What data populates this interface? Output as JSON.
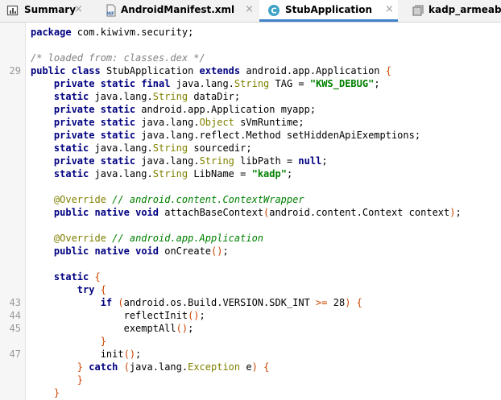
{
  "tabs": [
    {
      "label": "Summary",
      "icon": "summary-icon",
      "active": false
    },
    {
      "label": "AndroidManifest.xml",
      "icon": "manifest-file-icon",
      "active": false
    },
    {
      "label": "StubApplication",
      "icon": "class-icon",
      "active": true
    },
    {
      "label": "kadp_armeabi",
      "icon": "library-icon",
      "active": false
    }
  ],
  "tab_close_glyph": "×",
  "colors": {
    "active_tab_underline": "#4083c9",
    "keyword": "#000080",
    "string": "#008000",
    "comment": "#808080"
  },
  "gutter": {
    "line_numbers": [
      "29",
      "43",
      "44",
      "45",
      "47"
    ]
  },
  "code": {
    "line1": [
      "package",
      " com.kiwivm.security;"
    ],
    "line3": [
      "/* loaded from: classes.dex */"
    ],
    "line4": [
      "public",
      " ",
      "class",
      " StubApplication ",
      "extends",
      " android.app.Application ",
      "{"
    ],
    "line5": [
      "    ",
      "private",
      " ",
      "static",
      " ",
      "final",
      " java.lang.",
      "String",
      " TAG = ",
      "\"KWS_DEBUG\"",
      ";"
    ],
    "line6": [
      "    ",
      "static",
      " java.lang.",
      "String",
      " dataDir;"
    ],
    "line7": [
      "    ",
      "private",
      " ",
      "static",
      " android.app.Application myapp;"
    ],
    "line8": [
      "    ",
      "private",
      " ",
      "static",
      " java.lang.",
      "Object",
      " sVmRuntime;"
    ],
    "line9": [
      "    ",
      "private",
      " ",
      "static",
      " java.lang.reflect.Method setHiddenApiExemptions;"
    ],
    "line10": [
      "    ",
      "static",
      " java.lang.",
      "String",
      " sourcedir;"
    ],
    "line11": [
      "    ",
      "private",
      " ",
      "static",
      " java.lang.",
      "String",
      " libPath = ",
      "null",
      ";"
    ],
    "line12": [
      "    ",
      "static",
      " java.lang.",
      "String",
      " LibName = ",
      "\"kadp\"",
      ";"
    ],
    "line14": [
      "    ",
      "@Override",
      " ",
      "// android.content.ContextWrapper"
    ],
    "line15": [
      "    ",
      "public",
      " ",
      "native",
      " ",
      "void",
      " attachBaseContext",
      "(",
      "android.content.Context context",
      ")",
      ";"
    ],
    "line17": [
      "    ",
      "@Override",
      " ",
      "// android.app.Application"
    ],
    "line18": [
      "    ",
      "public",
      " ",
      "native",
      " ",
      "void",
      " onCreate",
      "()",
      ";"
    ],
    "line20": [
      "    ",
      "static",
      " ",
      "{"
    ],
    "line21": [
      "        ",
      "try",
      " ",
      "{"
    ],
    "line22": [
      "            ",
      "if",
      " ",
      "(",
      "android.os.Build.VERSION.SDK_INT ",
      ">=",
      " 28",
      ")",
      " ",
      "{"
    ],
    "line23": [
      "                reflectInit",
      "()",
      ";"
    ],
    "line24": [
      "                exemptAll",
      "()",
      ";"
    ],
    "line25": [
      "            ",
      "}"
    ],
    "line26": [
      "            init",
      "()",
      ";"
    ],
    "line27": [
      "        ",
      "}",
      " ",
      "catch",
      " ",
      "(",
      "java.lang.",
      "Exception",
      " e",
      ")",
      " ",
      "{"
    ],
    "line28": [
      "        ",
      "}"
    ],
    "line29": [
      "    ",
      "}"
    ]
  }
}
